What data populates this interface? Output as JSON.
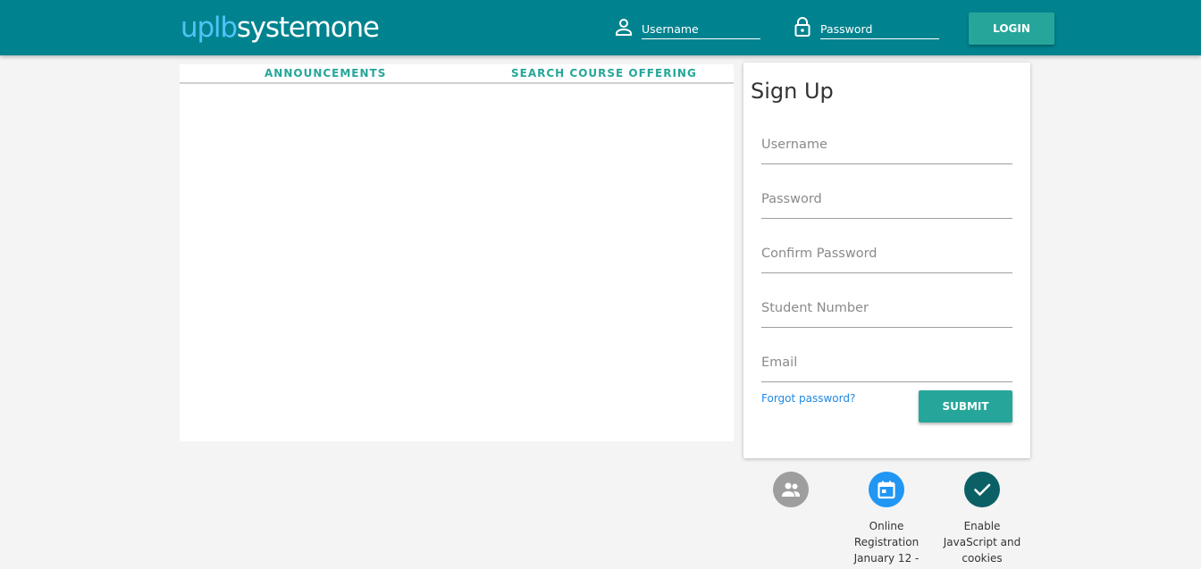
{
  "header": {
    "logo_part1": "uplb",
    "logo_part2": "systemone",
    "username_placeholder": "Username",
    "password_placeholder": "Password",
    "login_label": "LOGIN",
    "background_color": "#00838f"
  },
  "tabs": [
    {
      "label": "ANNOUNCEMENTS"
    },
    {
      "label": "SEARCH COURSE OFFERING"
    }
  ],
  "signup": {
    "title": "Sign Up",
    "fields": [
      {
        "placeholder": "Username"
      },
      {
        "placeholder": "Password"
      },
      {
        "placeholder": "Confirm Password"
      },
      {
        "placeholder": "Student Number"
      },
      {
        "placeholder": "Email"
      }
    ],
    "forgot_label": "Forgot password?",
    "submit_label": "SUBMIT",
    "button_color": "#26a69a"
  },
  "info_icons": [
    {
      "icon": "people-icon",
      "color": "#9e9e9e",
      "label_lines": []
    },
    {
      "icon": "calendar-icon",
      "color": "#2196f3",
      "label_lines": [
        "Online",
        "Registration",
        "January 12 -"
      ]
    },
    {
      "icon": "check-icon",
      "color": "#0b6066",
      "label_lines": [
        "Enable",
        "JavaScript and",
        "cookies"
      ]
    }
  ]
}
